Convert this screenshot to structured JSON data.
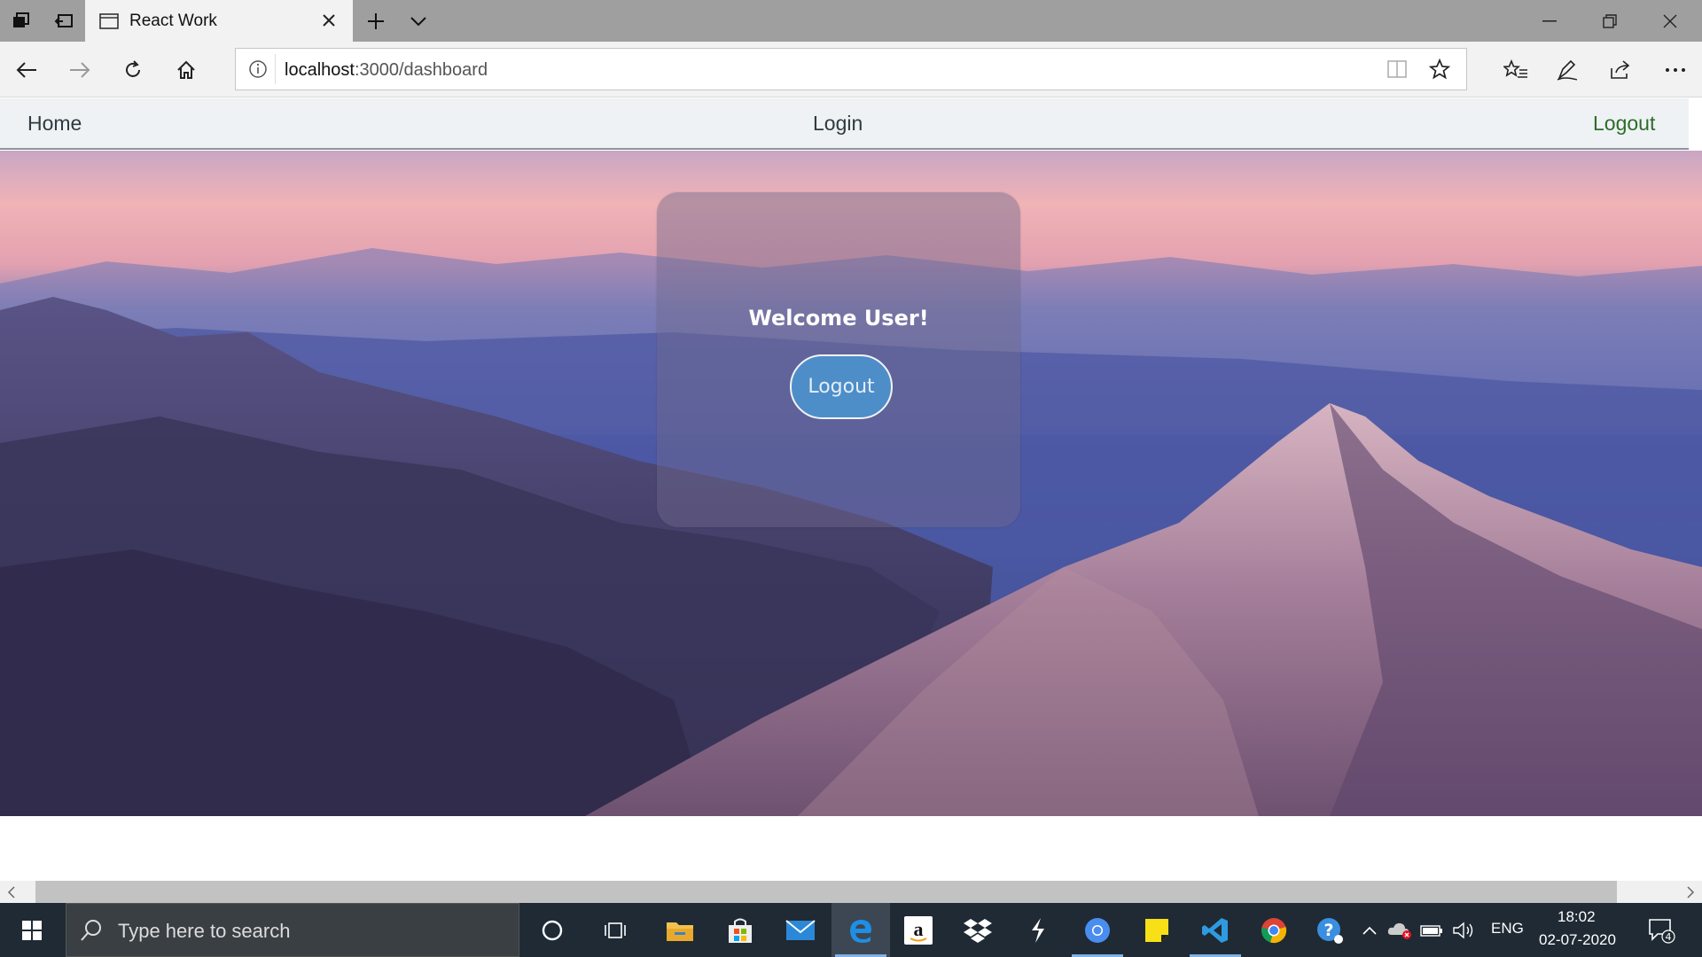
{
  "browser": {
    "tab_title": "React Work",
    "url_host": "localhost",
    "url_path": ":3000/dashboard"
  },
  "app_nav": {
    "home": "Home",
    "login": "Login",
    "logout": "Logout"
  },
  "card": {
    "welcome": "Welcome User!",
    "logout_button": "Logout"
  },
  "taskbar": {
    "search_placeholder": "Type here to search",
    "language": "ENG",
    "time": "18:02",
    "date": "02-07-2020",
    "notification_count": "4"
  },
  "colors": {
    "accent": "#4d8ec9",
    "logout_link": "#2e6b2a",
    "taskbar": "#1f2a34"
  }
}
